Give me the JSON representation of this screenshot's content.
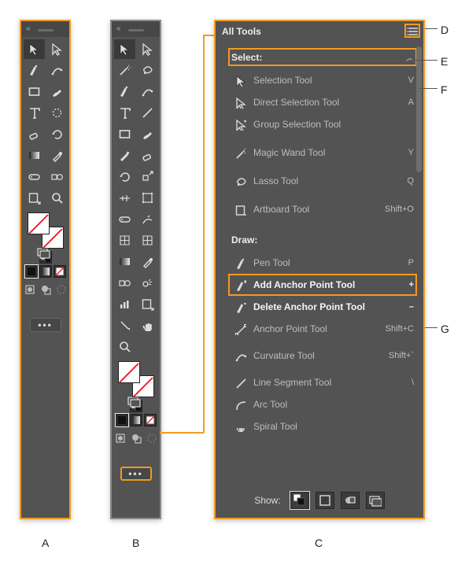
{
  "letters": {
    "A": "A",
    "B": "B",
    "C": "C",
    "D": "D",
    "E": "E",
    "F": "F",
    "G": "G"
  },
  "drawer": {
    "title": "All Tools",
    "show_label": "Show:",
    "sections": {
      "select": {
        "label": "Select:",
        "tools": [
          {
            "name": "Selection Tool",
            "shortcut": "V"
          },
          {
            "name": "Direct Selection Tool",
            "shortcut": "A"
          },
          {
            "name": "Group Selection Tool",
            "shortcut": ""
          },
          {
            "name": "Magic Wand Tool",
            "shortcut": "Y"
          },
          {
            "name": "Lasso Tool",
            "shortcut": "Q"
          },
          {
            "name": "Artboard Tool",
            "shortcut": "Shift+O"
          }
        ]
      },
      "draw": {
        "label": "Draw:",
        "tools": [
          {
            "name": "Pen Tool",
            "shortcut": "P"
          },
          {
            "name": "Add Anchor Point Tool",
            "shortcut": "+"
          },
          {
            "name": "Delete Anchor Point Tool",
            "shortcut": "–"
          },
          {
            "name": "Anchor Point Tool",
            "shortcut": "Shift+C"
          },
          {
            "name": "Curvature Tool",
            "shortcut": "Shift+`"
          },
          {
            "name": "Line Segment Tool",
            "shortcut": "\\"
          },
          {
            "name": "Arc Tool",
            "shortcut": ""
          },
          {
            "name": "Spiral Tool",
            "shortcut": ""
          }
        ]
      }
    }
  }
}
